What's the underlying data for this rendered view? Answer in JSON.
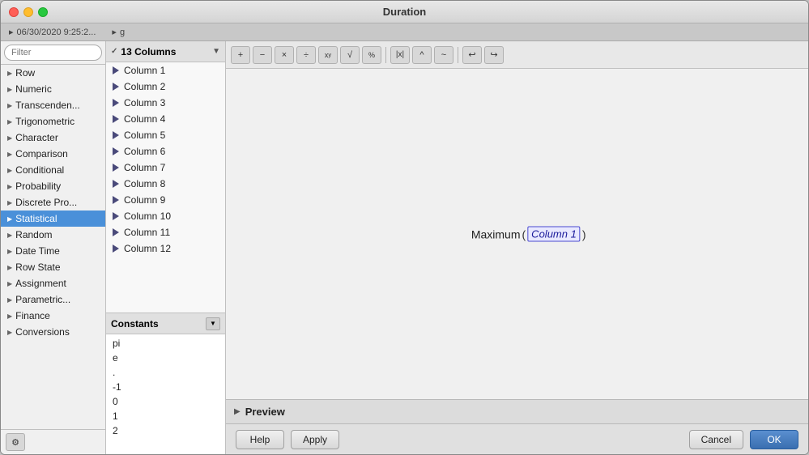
{
  "window": {
    "title": "Duration"
  },
  "top_strip": {
    "item1": "06/30/2020 9:25:2...",
    "item2": "g"
  },
  "filter": {
    "placeholder": "Filter"
  },
  "function_categories": [
    {
      "id": "row",
      "label": "Row",
      "selected": false
    },
    {
      "id": "numeric",
      "label": "Numeric",
      "selected": false
    },
    {
      "id": "transcendental",
      "label": "Transcenden...",
      "selected": false
    },
    {
      "id": "trigonometric",
      "label": "Trigonometric",
      "selected": false
    },
    {
      "id": "character",
      "label": "Character",
      "selected": false
    },
    {
      "id": "comparison",
      "label": "Comparison",
      "selected": false
    },
    {
      "id": "conditional",
      "label": "Conditional",
      "selected": false
    },
    {
      "id": "probability",
      "label": "Probability",
      "selected": false
    },
    {
      "id": "discrete_pro",
      "label": "Discrete Pro...",
      "selected": false
    },
    {
      "id": "statistical",
      "label": "Statistical",
      "selected": true
    },
    {
      "id": "random",
      "label": "Random",
      "selected": false
    },
    {
      "id": "date_time",
      "label": "Date Time",
      "selected": false
    },
    {
      "id": "row_state",
      "label": "Row State",
      "selected": false
    },
    {
      "id": "assignment",
      "label": "Assignment",
      "selected": false
    },
    {
      "id": "parametric",
      "label": "Parametric...",
      "selected": false
    },
    {
      "id": "finance",
      "label": "Finance",
      "selected": false
    },
    {
      "id": "conversions",
      "label": "Conversions",
      "selected": false
    }
  ],
  "columns_header": "13 Columns",
  "columns": [
    {
      "id": "col1",
      "label": "Column 1"
    },
    {
      "id": "col2",
      "label": "Column 2"
    },
    {
      "id": "col3",
      "label": "Column 3"
    },
    {
      "id": "col4",
      "label": "Column 4"
    },
    {
      "id": "col5",
      "label": "Column 5"
    },
    {
      "id": "col6",
      "label": "Column 6"
    },
    {
      "id": "col7",
      "label": "Column 7"
    },
    {
      "id": "col8",
      "label": "Column 8"
    },
    {
      "id": "col9",
      "label": "Column 9"
    },
    {
      "id": "col10",
      "label": "Column 10"
    },
    {
      "id": "col11",
      "label": "Column 11"
    },
    {
      "id": "col12",
      "label": "Column 12"
    }
  ],
  "constants_header": "Constants",
  "constants": [
    {
      "id": "pi",
      "label": "pi"
    },
    {
      "id": "e",
      "label": "e"
    },
    {
      "id": "dot",
      "label": "."
    },
    {
      "id": "neg1",
      "label": "-1"
    },
    {
      "id": "zero",
      "label": "0"
    },
    {
      "id": "one",
      "label": "1"
    },
    {
      "id": "two",
      "label": "2"
    }
  ],
  "toolbar_buttons": [
    {
      "id": "plus",
      "label": "+"
    },
    {
      "id": "minus",
      "label": "−"
    },
    {
      "id": "multiply",
      "label": "×"
    },
    {
      "id": "divide",
      "label": "÷"
    },
    {
      "id": "power",
      "label": "xʸ"
    },
    {
      "id": "sqrt",
      "label": "√"
    },
    {
      "id": "pct",
      "label": "%"
    },
    {
      "id": "abs",
      "label": "|x|"
    },
    {
      "id": "caret",
      "label": "^"
    },
    {
      "id": "tilde",
      "label": "~"
    },
    {
      "id": "undo",
      "label": "↩"
    },
    {
      "id": "redo",
      "label": "↪"
    }
  ],
  "formula": {
    "function_name": "Maximum",
    "open_paren": "(",
    "argument": "Column 1",
    "close_paren": ")"
  },
  "preview": {
    "label": "Preview"
  },
  "buttons": {
    "help": "Help",
    "apply": "Apply",
    "cancel": "Cancel",
    "ok": "OK"
  }
}
